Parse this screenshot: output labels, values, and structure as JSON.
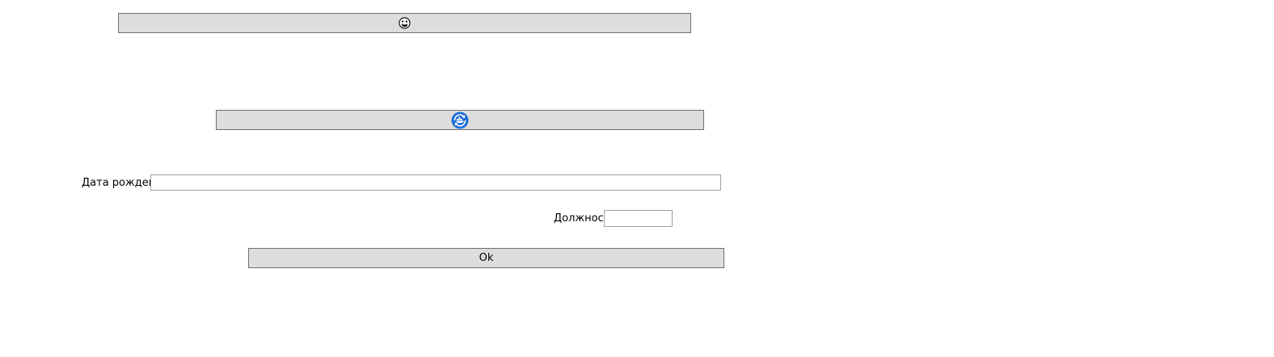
{
  "buttons": {
    "top": {
      "icon": "grinning-face-icon",
      "label": ""
    },
    "refresh": {
      "icon": "docker-refresh-icon",
      "label": ""
    },
    "ok": {
      "label": "Ok"
    }
  },
  "fields": {
    "birthdate": {
      "label": "Дата рождения",
      "value": ""
    },
    "position": {
      "label": "Должность",
      "value": ""
    }
  },
  "colors": {
    "button_bg": "#dddddd",
    "button_border": "#707070",
    "input_border": "#a0a0a0",
    "icon_blue": "#1e6fd9"
  }
}
